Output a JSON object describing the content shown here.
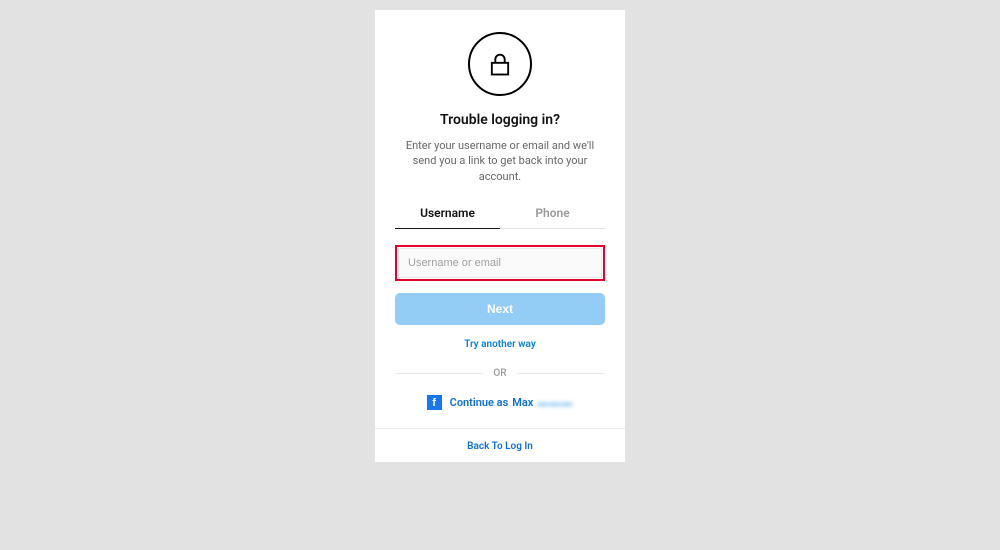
{
  "header": {
    "title": "Trouble logging in?",
    "subtitle": "Enter your username or email and we'll send you a link to get back into your account."
  },
  "tabs": {
    "username_label": "Username",
    "phone_label": "Phone"
  },
  "form": {
    "placeholder": "Username or email",
    "next_label": "Next",
    "try_another_label": "Try another way"
  },
  "divider": {
    "or_label": "OR"
  },
  "facebook": {
    "continue_prefix": "Continue as",
    "user_first_name": "Max",
    "user_last_name_obscured": "▬▬▬"
  },
  "footer": {
    "back_label": "Back To Log In"
  }
}
